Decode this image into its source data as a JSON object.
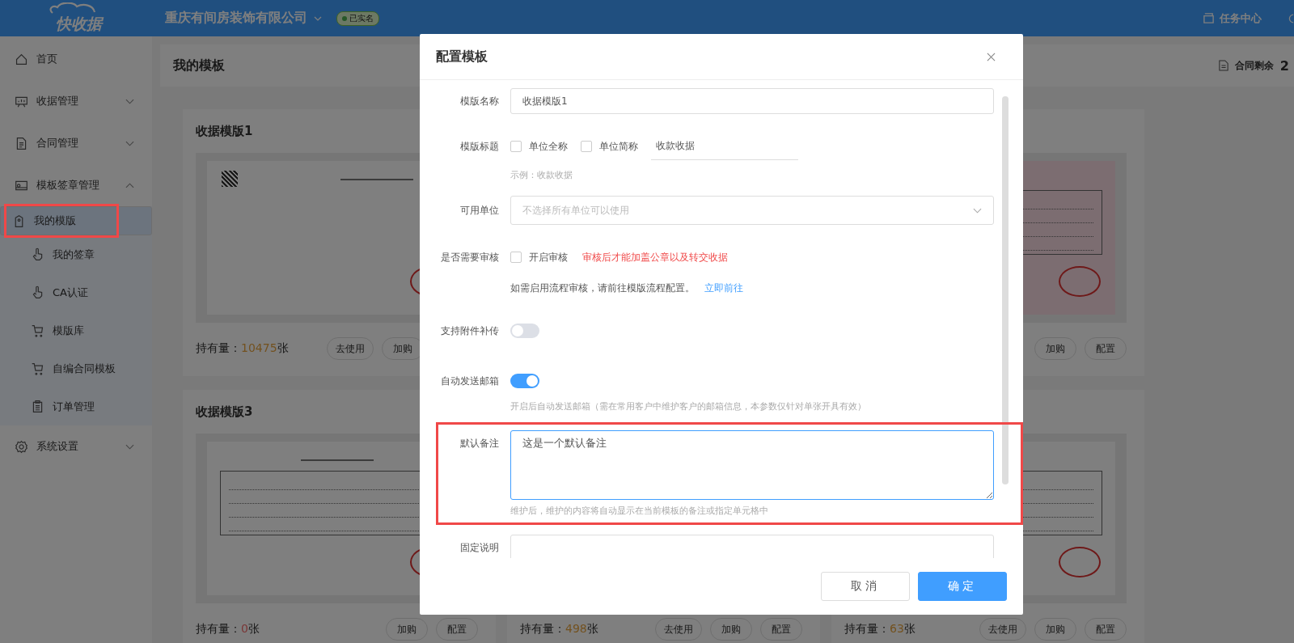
{
  "topbar": {
    "logo": "快收据",
    "company": "重庆有间房装饰有限公司",
    "verified_badge": "已实名",
    "task_center": "任务中心"
  },
  "sidebar": {
    "items": [
      {
        "label": "首页",
        "kind": "link"
      },
      {
        "label": "收据管理",
        "kind": "group",
        "expanded": false
      },
      {
        "label": "合同管理",
        "kind": "group",
        "expanded": false
      },
      {
        "label": "模板签章管理",
        "kind": "group",
        "expanded": true,
        "children": [
          {
            "label": "我的模版",
            "selected": true,
            "highlighted": true
          },
          {
            "label": "我的签章",
            "selected": false,
            "highlighted": false
          },
          {
            "label": "CA认证",
            "selected": false,
            "highlighted": false
          },
          {
            "label": "模版库",
            "selected": false,
            "highlighted": false
          },
          {
            "label": "自编合同模板",
            "selected": false,
            "highlighted": false
          },
          {
            "label": "订单管理",
            "selected": false,
            "highlighted": false
          }
        ]
      },
      {
        "label": "系统设置",
        "kind": "group",
        "expanded": false
      }
    ]
  },
  "main": {
    "title": "我的模板",
    "remaining_label": "合同剩余",
    "remaining_value": "2"
  },
  "card_rows": [
    [
      {
        "title": "收据模版1",
        "preview": {
          "kind": "grid",
          "tinted": false
        },
        "count_label": "持有量：",
        "count": "10475",
        "unit": "张",
        "color": "#73511e",
        "buttons": [
          "去使用",
          "加购"
        ]
      },
      {
        "preview": {
          "kind": "lined",
          "tinted": true
        },
        "buttons": [
          "加购",
          "配置"
        ]
      }
    ],
    [
      {
        "title": "收据模版3",
        "preview": {
          "kind": "lined",
          "tinted": false
        },
        "count_label": "持有量：",
        "count": "0",
        "unit": "张",
        "color": "#7a3636",
        "buttons": [
          "加购",
          "配置"
        ]
      },
      {
        "count_label": "持有量：",
        "count": "498",
        "unit": "张",
        "color": "#73511e",
        "buttons": [
          "去使用",
          "加购",
          "配置"
        ]
      },
      {
        "preview": {
          "kind": "lined",
          "tinted": false
        },
        "count_label": "持有量：",
        "count": "63",
        "unit": "张",
        "color": "#73511e",
        "buttons": [
          "去使用",
          "加购",
          "配置"
        ]
      }
    ]
  ],
  "dialog": {
    "title": "配置模板",
    "fields": [
      {
        "kind": "input",
        "label": "模版名称",
        "value": "收据模版1"
      },
      {
        "kind": "title",
        "label": "模版标题",
        "options": [
          {
            "label": "单位全称",
            "checked": false
          },
          {
            "label": "单位简称",
            "checked": false
          }
        ],
        "value": "收款收据",
        "hint": "示例：收款收据"
      },
      {
        "kind": "select",
        "label": "可用单位",
        "placeholder": "不选择所有单位可以使用"
      },
      {
        "kind": "review",
        "label": "是否需要审核",
        "option": {
          "label": "开启审核",
          "checked": false
        },
        "warning": "审核后才能加盖公章以及转交收据",
        "note": "如需启用流程审核，请前往模版流程配置。",
        "link": "立即前往"
      },
      {
        "kind": "switch",
        "label": "支持附件补传",
        "on": false
      },
      {
        "kind": "switch",
        "label": "自动发送邮箱",
        "on": true,
        "hint": "开启后自动发送邮箱（需在常用客户中维护客户的邮箱信息，本参数仅针对单张开具有效）"
      },
      {
        "kind": "textarea",
        "label": "默认备注",
        "value": "这是一个默认备注",
        "hint": "维护后，维护的内容将自动显示在当前模板的备注或指定单元格中",
        "highlighted": true
      },
      {
        "kind": "textarea",
        "label": "固定说明",
        "highlighted": false
      }
    ],
    "buttons": [
      {
        "label": "取消",
        "kind": "secondary"
      },
      {
        "label": "确定",
        "kind": "primary"
      }
    ]
  }
}
